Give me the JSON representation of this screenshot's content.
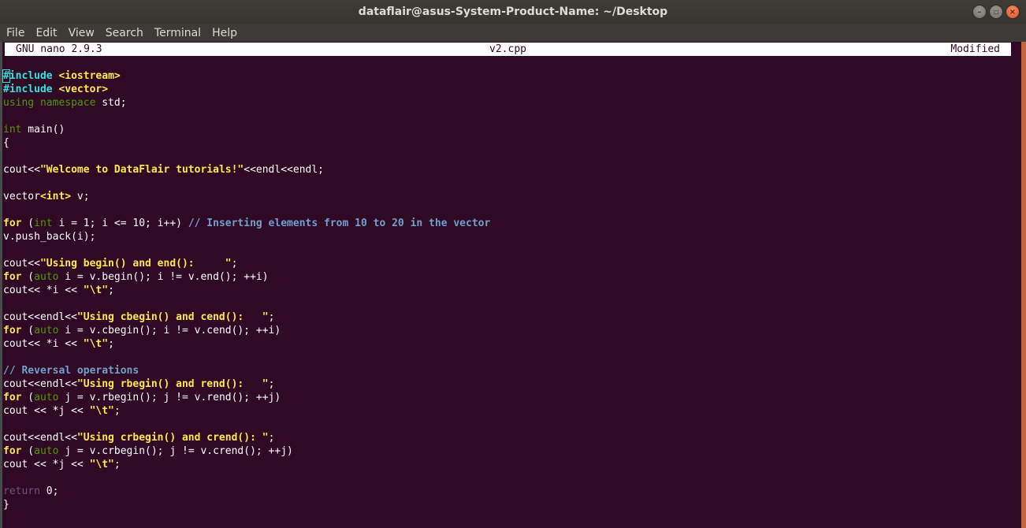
{
  "window": {
    "title": "dataflair@asus-System-Product-Name: ~/Desktop",
    "controls": [
      "minimize",
      "maximize",
      "close"
    ]
  },
  "menubar": {
    "items": [
      "File",
      "Edit",
      "View",
      "Search",
      "Terminal",
      "Help"
    ]
  },
  "nano": {
    "version": "GNU nano 2.9.3",
    "filename": "v2.cpp",
    "status": "Modified"
  },
  "code": {
    "lines": [
      [
        {
          "t": "#",
          "c": "pp cursor"
        },
        {
          "t": "include ",
          "c": "pp"
        },
        {
          "t": "<iostream>",
          "c": "inc"
        }
      ],
      [
        {
          "t": "#include ",
          "c": "pp"
        },
        {
          "t": "<vector>",
          "c": "inc"
        }
      ],
      [
        {
          "t": "using namespace",
          "c": "kw"
        },
        {
          "t": " std;",
          "c": ""
        }
      ],
      [],
      [
        {
          "t": "int",
          "c": "kw"
        },
        {
          "t": " main()",
          "c": ""
        }
      ],
      [
        {
          "t": "{",
          "c": ""
        }
      ],
      [],
      [
        {
          "t": "cout<<",
          "c": ""
        },
        {
          "t": "\"Welcome to DataFlair tutorials!\"",
          "c": "str"
        },
        {
          "t": "<<endl<<endl;",
          "c": ""
        }
      ],
      [],
      [
        {
          "t": "vector",
          "c": ""
        },
        {
          "t": "<int>",
          "c": "kwb"
        },
        {
          "t": " v;",
          "c": ""
        }
      ],
      [],
      [
        {
          "t": "for",
          "c": "kwb"
        },
        {
          "t": " (",
          "c": ""
        },
        {
          "t": "int",
          "c": "kw"
        },
        {
          "t": " i = 1; i <= 10; i++) ",
          "c": ""
        },
        {
          "t": "// Inserting elements from 10 to 20 in the vector",
          "c": "cm"
        }
      ],
      [
        {
          "t": "v.push_back(i);",
          "c": ""
        }
      ],
      [],
      [
        {
          "t": "cout<<",
          "c": ""
        },
        {
          "t": "\"Using begin() and end():     \"",
          "c": "str"
        },
        {
          "t": ";",
          "c": ""
        }
      ],
      [
        {
          "t": "for",
          "c": "kwb"
        },
        {
          "t": " (",
          "c": ""
        },
        {
          "t": "auto",
          "c": "kw"
        },
        {
          "t": " i = v.begin(); i != v.end(); ++i)",
          "c": ""
        }
      ],
      [
        {
          "t": "cout<< *i << ",
          "c": ""
        },
        {
          "t": "\"\\t\"",
          "c": "str"
        },
        {
          "t": ";",
          "c": ""
        }
      ],
      [],
      [
        {
          "t": "cout<<endl<<",
          "c": ""
        },
        {
          "t": "\"Using cbegin() and cend():   \"",
          "c": "str"
        },
        {
          "t": ";",
          "c": ""
        }
      ],
      [
        {
          "t": "for",
          "c": "kwb"
        },
        {
          "t": " (",
          "c": ""
        },
        {
          "t": "auto",
          "c": "kw"
        },
        {
          "t": " i = v.cbegin(); i != v.cend(); ++i)",
          "c": ""
        }
      ],
      [
        {
          "t": "cout<< *i << ",
          "c": ""
        },
        {
          "t": "\"\\t\"",
          "c": "str"
        },
        {
          "t": ";",
          "c": ""
        }
      ],
      [],
      [
        {
          "t": "// Reversal operations",
          "c": "cm"
        }
      ],
      [
        {
          "t": "cout<<endl<<",
          "c": ""
        },
        {
          "t": "\"Using rbegin() and rend():   \"",
          "c": "str"
        },
        {
          "t": ";",
          "c": ""
        }
      ],
      [
        {
          "t": "for",
          "c": "kwb"
        },
        {
          "t": " (",
          "c": ""
        },
        {
          "t": "auto",
          "c": "kw"
        },
        {
          "t": " j = v.rbegin(); j != v.rend(); ++j)",
          "c": ""
        }
      ],
      [
        {
          "t": "cout << *j << ",
          "c": ""
        },
        {
          "t": "\"\\t\"",
          "c": "str"
        },
        {
          "t": ";",
          "c": ""
        }
      ],
      [],
      [
        {
          "t": "cout<<endl<<",
          "c": ""
        },
        {
          "t": "\"Using crbegin() and crend(): \"",
          "c": "str"
        },
        {
          "t": ";",
          "c": ""
        }
      ],
      [
        {
          "t": "for",
          "c": "kwb"
        },
        {
          "t": " (",
          "c": ""
        },
        {
          "t": "auto",
          "c": "kw"
        },
        {
          "t": " j = v.crbegin(); j != v.crend(); ++j)",
          "c": ""
        }
      ],
      [
        {
          "t": "cout << *j << ",
          "c": ""
        },
        {
          "t": "\"\\t\"",
          "c": "str"
        },
        {
          "t": ";",
          "c": ""
        }
      ],
      [],
      [
        {
          "t": "return",
          "c": "ret"
        },
        {
          "t": " 0;",
          "c": ""
        }
      ],
      [
        {
          "t": "}",
          "c": ""
        }
      ]
    ]
  }
}
